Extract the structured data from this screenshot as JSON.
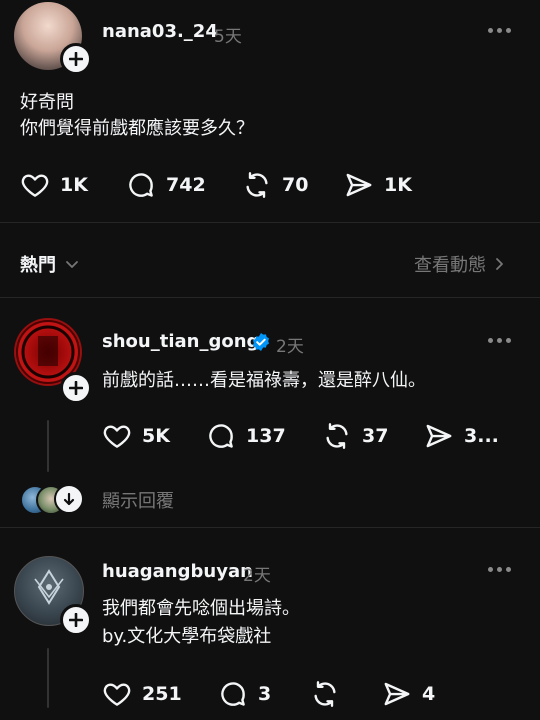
{
  "posts": [
    {
      "username": "nana03._24",
      "time": "5天",
      "lines": [
        "好奇問",
        "你們覺得前戲都應該要多久？"
      ],
      "likes": "1K",
      "comments": "742",
      "reposts": "70",
      "shares": "1K"
    }
  ],
  "sort_bar": {
    "label": "熱門",
    "activity_link": "查看動態"
  },
  "replies": [
    {
      "username": "shou_tian_gong",
      "time": "2天",
      "verified": true,
      "lines": [
        "前戲的話……看是福祿壽，還是醉八仙。"
      ],
      "likes": "5K",
      "comments": "137",
      "reposts": "37",
      "shares": "3...",
      "show_replies": "顯示回覆"
    },
    {
      "username": "huagangbuyan",
      "time": "2天",
      "lines": [
        "我們都會先唸個出場詩。",
        "by.文化大學布袋戲社"
      ],
      "likes": "251",
      "comments": "3",
      "reposts": "",
      "shares": "4"
    }
  ],
  "colors": {
    "background": "#101010",
    "text": "#f3f5f7",
    "muted": "#777777",
    "verified": "#0095f6"
  }
}
